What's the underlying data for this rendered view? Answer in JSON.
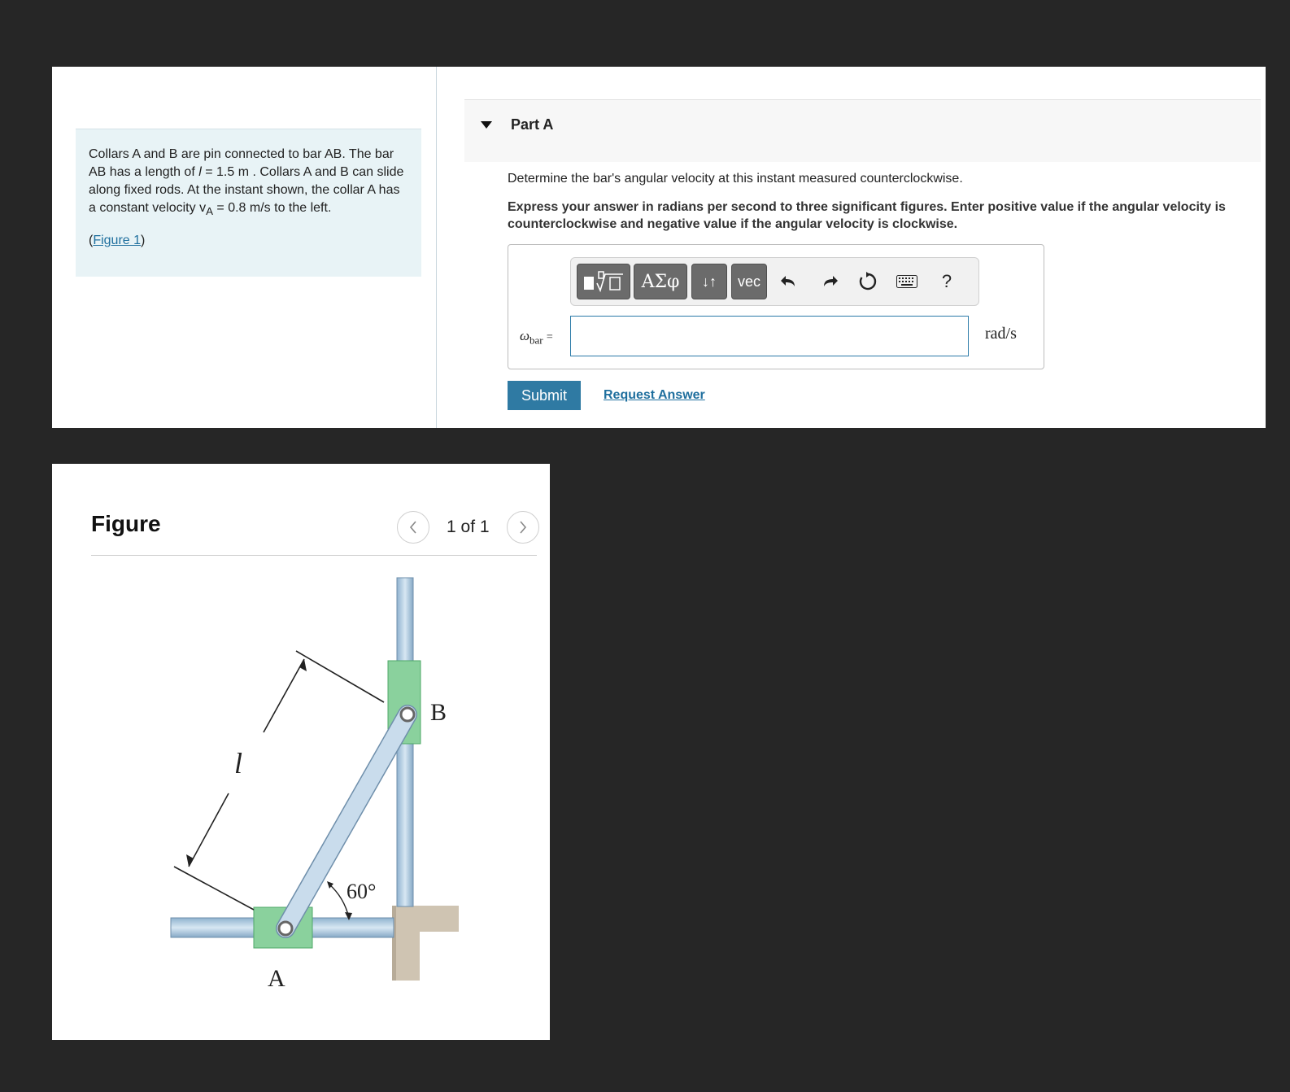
{
  "problem": {
    "text_1": "Collars A and B are pin connected to bar AB. The bar AB has a length of",
    "l_symbol": "l",
    "text_2": "= 1.5 m . Collars A and B can slide along fixed rods. At the instant shown, the collar A has a constant velocity v",
    "v_sub": "A",
    "text_3": "= 0.8 m/s to the left.",
    "figure_link": "Figure 1",
    "figure_open": "(",
    "figure_close": ")"
  },
  "part": {
    "title": "Part A",
    "question": "Determine  the bar's angular velocity at this instant measured counterclockwise.",
    "instructions": "Express your answer in radians per second to three significant figures. Enter positive value if the angular velocity is counterclockwise and negative value if the angular velocity is clockwise.",
    "variable": "ω",
    "variable_sub": "bar",
    "equals": "=",
    "answer_value": "",
    "units": "rad/s",
    "submit_label": "Submit",
    "request_label": "Request Answer"
  },
  "toolbar": {
    "greek_label": "ΑΣφ",
    "arrows_label": "↓↑",
    "vec_label": "vec",
    "help_label": "?"
  },
  "figure": {
    "title": "Figure",
    "page_indicator": "1 of 1",
    "label_a": "A",
    "label_b": "B",
    "label_l": "l",
    "angle_label": "60°"
  }
}
